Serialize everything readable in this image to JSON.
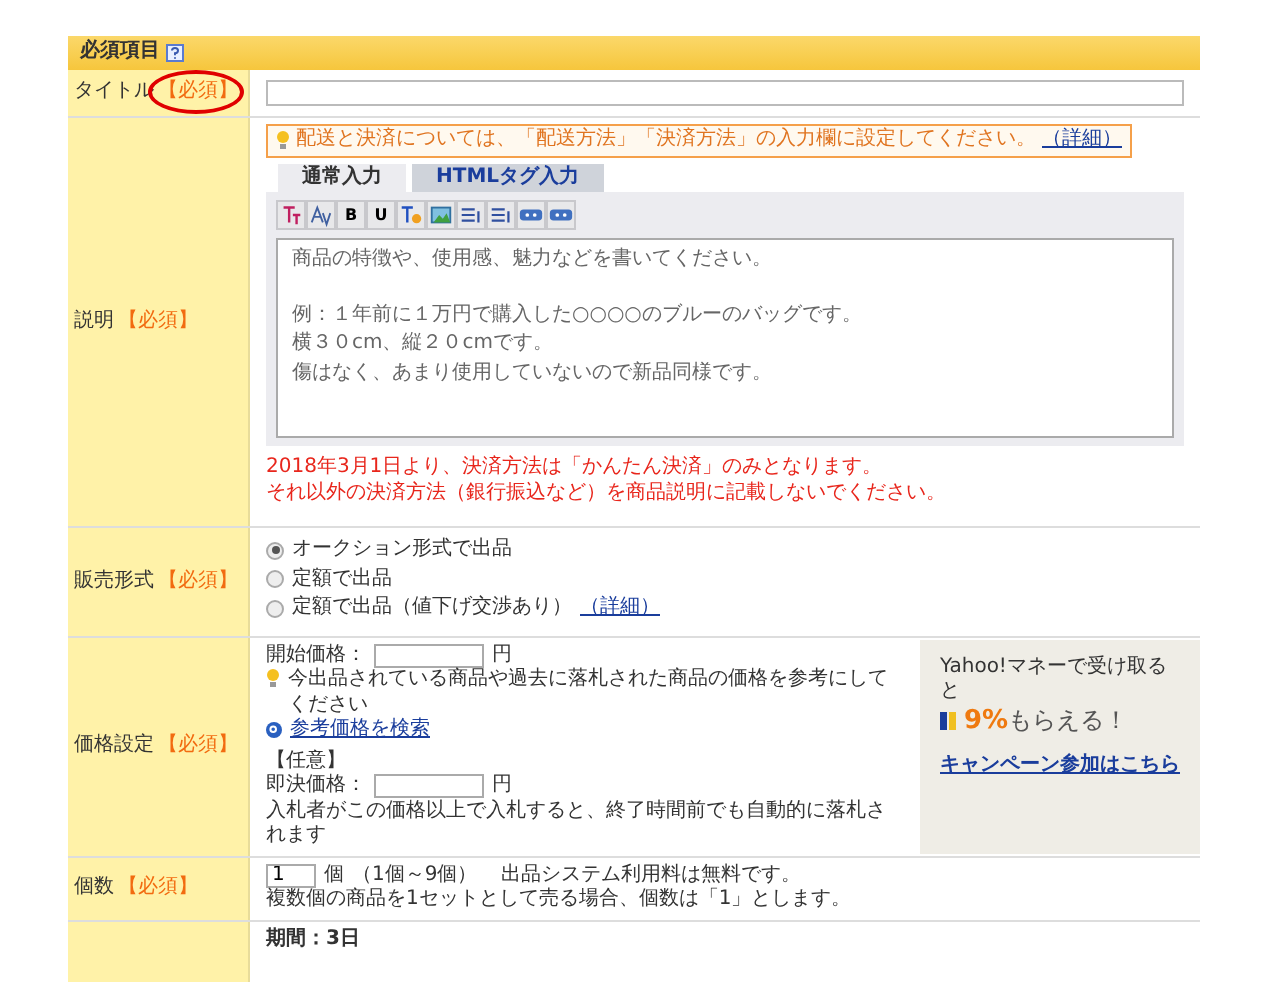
{
  "section": {
    "title": "必須項目"
  },
  "rows": [
    {
      "kind": "title",
      "label": "タイトル",
      "required": "【必須】",
      "circled": true
    },
    {
      "kind": "description",
      "label": "説明",
      "required": "【必須】",
      "notice": {
        "text": "配送と決済については、「配送方法」「決済方法」の入力欄に設定してください。",
        "link": "（詳細）"
      },
      "tabs": [
        {
          "label": "通常入力",
          "selected": true
        },
        {
          "label": "HTMLタグ入力",
          "selected": false
        }
      ],
      "toolbar": [
        {
          "kind": "font"
        },
        {
          "kind": "size"
        },
        {
          "kind": "letter",
          "label": "B"
        },
        {
          "kind": "letter",
          "label": "U"
        },
        {
          "kind": "color"
        },
        {
          "kind": "image"
        },
        {
          "kind": "list"
        },
        {
          "kind": "list"
        },
        {
          "kind": "emoji"
        },
        {
          "kind": "emoji"
        }
      ],
      "placeholder_lines": [
        "商品の特徴や、使用感、魅力などを書いてください。",
        "例：１年前に１万円で購入した○○○○のブルーのバッグです。",
        "横３０cm、縦２０cmです。",
        "傷はなく、あまり使用していないので新品同様です。"
      ],
      "warning": [
        "2018年3月1日より、決済方法は「かんたん決済」のみとなります。",
        "それ以外の決済方法（銀行振込など）を商品説明に記載しないでください。"
      ]
    },
    {
      "kind": "format",
      "label": "販売形式",
      "required": "【必須】",
      "options": [
        {
          "label": "オークション形式で出品",
          "selected": true
        },
        {
          "label": "定額で出品",
          "selected": false
        },
        {
          "label": "定額で出品（値下げ交渉あり）",
          "selected": false,
          "link": "（詳細）"
        }
      ]
    },
    {
      "kind": "price",
      "label": "価格設定",
      "required": "【必須】",
      "start_label": "開始価格：",
      "start_unit": "円",
      "hint": "今出品されている商品や過去に落札された商品の価格を参考にしてください",
      "search_link": "参考価格を検索",
      "optional": "【任意】",
      "buyout_label": "即決価格：",
      "buyout_unit": "円",
      "buyout_note": "入札者がこの価格以上で入札すると、終了時間前でも自動的に落札されます",
      "promo": {
        "line1": "Yahoo!マネーで受け取ると",
        "rate": "9%",
        "rest": "もらえる！",
        "link": "キャンペーン参加はこちら"
      }
    },
    {
      "kind": "quantity",
      "label": "個数",
      "required": "【必須】",
      "value": "1",
      "unit": "個",
      "range": "（1個～9個）",
      "fee": "出品システム利用料は無料です。",
      "note": "複数個の商品を1セットとして売る場合、個数は「1」とします。"
    },
    {
      "kind": "period",
      "period": "期間：3日"
    }
  ]
}
